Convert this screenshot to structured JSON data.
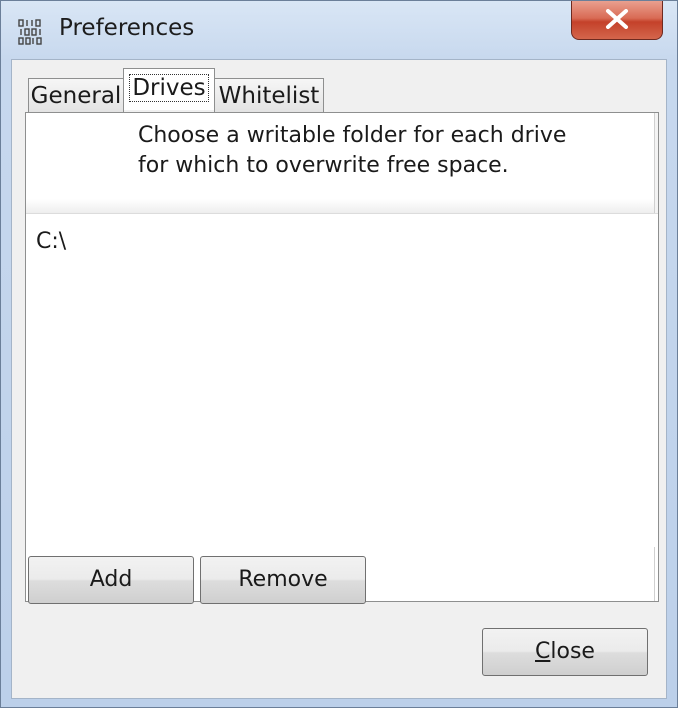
{
  "window": {
    "title": "Preferences",
    "icon": "binary-digits-icon"
  },
  "tabs": [
    {
      "label": "General",
      "active": false
    },
    {
      "label": "Drives",
      "active": true
    },
    {
      "label": "Whitelist",
      "active": false
    }
  ],
  "drives_tab": {
    "description_line1": "Choose a writable folder for each drive",
    "description_line2": "for which to overwrite free space.",
    "folders": [
      "C:\\"
    ],
    "add_label": "Add",
    "remove_label": "Remove"
  },
  "footer": {
    "close_label_prefix": "",
    "close_label_mnemonic": "C",
    "close_label_rest": "lose"
  },
  "colors": {
    "close_button": "#c4412a",
    "frame": "#c7d8ee"
  }
}
